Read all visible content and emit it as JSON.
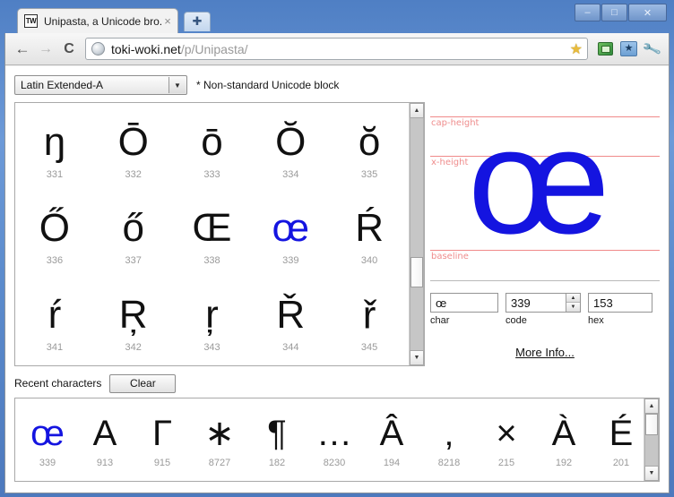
{
  "window": {
    "minimize_label": "–",
    "maximize_label": "□",
    "close_label": "✕"
  },
  "tab": {
    "favicon_text": "TW",
    "title": "Unipasta, a Unicode bro...",
    "close_label": "×",
    "newtab_label": "✚"
  },
  "toolbar": {
    "back_label": "←",
    "forward_label": "→",
    "reload_label": "C",
    "url_host": "toki-woki.net",
    "url_path": "/p/Unipasta/",
    "star_label": "★",
    "bookmark_label": "★",
    "wrench_label": "🔧"
  },
  "controls": {
    "block_select_value": "Latin Extended-A",
    "block_select_arrow": "▼",
    "note": "* Non-standard Unicode block"
  },
  "grid": {
    "cells": [
      {
        "glyph": "ŋ",
        "code": "331"
      },
      {
        "glyph": "Ō",
        "code": "332"
      },
      {
        "glyph": "ō",
        "code": "333"
      },
      {
        "glyph": "Ŏ",
        "code": "334"
      },
      {
        "glyph": "ŏ",
        "code": "335"
      },
      {
        "glyph": "Ő",
        "code": "336"
      },
      {
        "glyph": "ő",
        "code": "337"
      },
      {
        "glyph": "Œ",
        "code": "338"
      },
      {
        "glyph": "œ",
        "code": "339",
        "selected": true
      },
      {
        "glyph": "Ŕ",
        "code": "340"
      },
      {
        "glyph": "ŕ",
        "code": "341"
      },
      {
        "glyph": "Ŗ",
        "code": "342"
      },
      {
        "glyph": "ŗ",
        "code": "343"
      },
      {
        "glyph": "Ř",
        "code": "344"
      },
      {
        "glyph": "ř",
        "code": "345"
      }
    ],
    "scroll_up": "▲",
    "scroll_down": "▼"
  },
  "preview": {
    "glyph": "œ",
    "guides": [
      {
        "label": "cap-height"
      },
      {
        "label": "x-height"
      },
      {
        "label": "baseline"
      }
    ],
    "glyph_color": "#1414e0",
    "guide_color": "#f08a8a"
  },
  "fields": {
    "char": {
      "value": "œ",
      "label": "char"
    },
    "code": {
      "value": "339",
      "label": "code",
      "spin_up": "▲",
      "spin_down": "▼"
    },
    "hex": {
      "value": "153",
      "label": "hex"
    },
    "more_info": "More Info..."
  },
  "recent": {
    "label": "Recent characters",
    "clear_label": "Clear",
    "scroll_up": "▲",
    "scroll_down": "▼",
    "items": [
      {
        "glyph": "œ",
        "code": "339",
        "selected": true
      },
      {
        "glyph": "Α",
        "code": "913"
      },
      {
        "glyph": "Γ",
        "code": "915"
      },
      {
        "glyph": "∗",
        "code": "8727"
      },
      {
        "glyph": "¶",
        "code": "182"
      },
      {
        "glyph": "…",
        "code": "8230"
      },
      {
        "glyph": "Â",
        "code": "194"
      },
      {
        "glyph": "‚",
        "code": "8218"
      },
      {
        "glyph": "×",
        "code": "215"
      },
      {
        "glyph": "À",
        "code": "192"
      },
      {
        "glyph": "É",
        "code": "201"
      }
    ]
  }
}
